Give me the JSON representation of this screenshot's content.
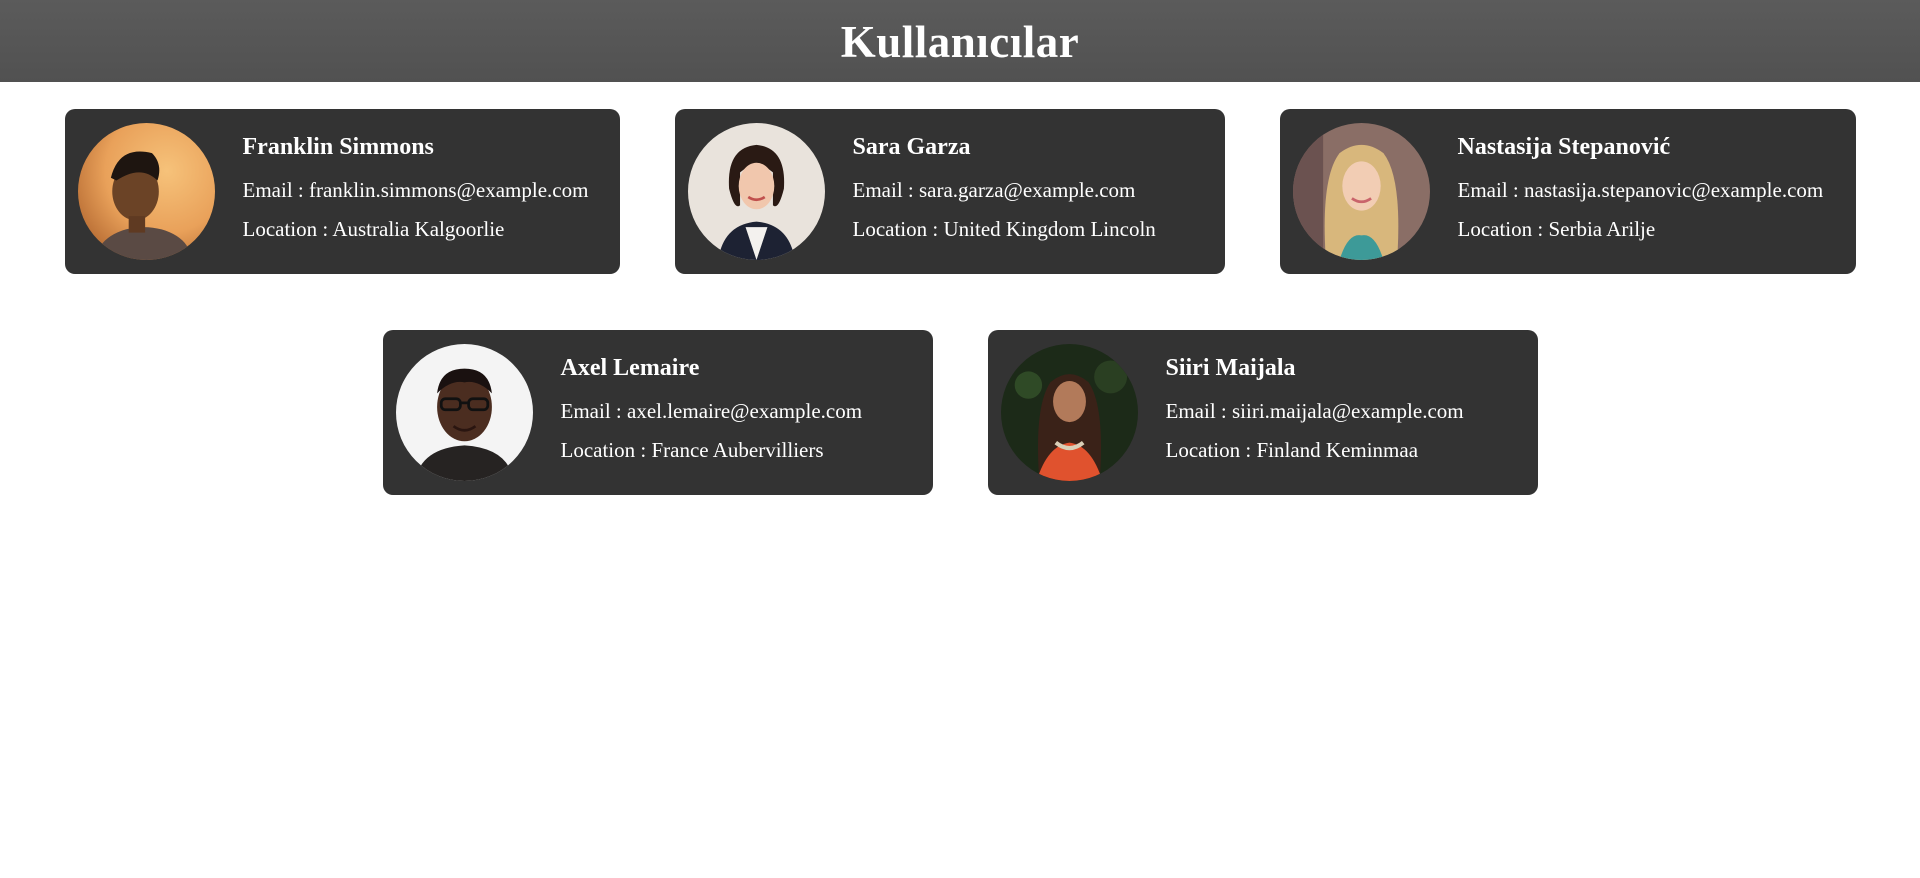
{
  "header": {
    "title": "Kullanıcılar"
  },
  "labels": {
    "email_prefix": "Email : ",
    "location_prefix": "Location : "
  },
  "users": [
    {
      "name": "Franklin Simmons",
      "email": "franklin.simmons@example.com",
      "location": "Australia Kalgoorlie"
    },
    {
      "name": "Sara Garza",
      "email": "sara.garza@example.com",
      "location": "United Kingdom Lincoln"
    },
    {
      "name": "Nastasija Stepanović",
      "email": "nastasija.stepanovic@example.com",
      "location": "Serbia Arilje"
    },
    {
      "name": "Axel Lemaire",
      "email": "axel.lemaire@example.com",
      "location": "France Aubervilliers"
    },
    {
      "name": "Siiri Maijala",
      "email": "siiri.maijala@example.com",
      "location": "Finland Keminmaa"
    }
  ],
  "colors": {
    "header_bg": "#585858",
    "card_bg": "#333333",
    "text": "#ffffff",
    "page_bg": "#ffffff"
  }
}
